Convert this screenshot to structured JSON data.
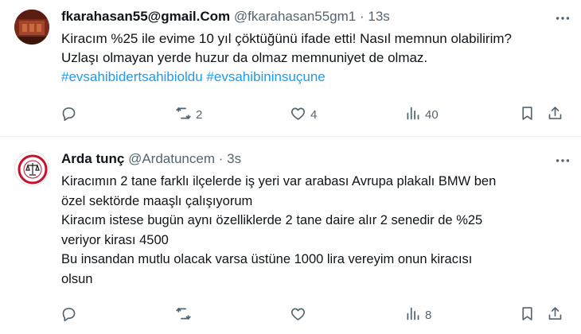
{
  "tweets": [
    {
      "name": "fkarahasan55@gmail.Com",
      "handle": "@fkarahasan55gm1",
      "time": "13s",
      "lines": [
        "Kiracım %25 ile evime 10 yıl çöktüğünü ifade etti! Nasıl memnun olabilirim?",
        "Uzlaşı olmayan yerde huzur da olmaz memnuniyet de olmaz."
      ],
      "hashtags": [
        "#evsahibidertsahibioldu",
        "#evsahibininsuçune"
      ],
      "counts": {
        "replies": "",
        "retweets": "2",
        "likes": "4",
        "views": "40"
      }
    },
    {
      "name": "Arda tunç",
      "handle": "@Ardatuncem",
      "time": "3s",
      "lines": [
        "Kiracımın 2 tane farklı ilçelerde iş yeri var arabası Avrupa plakalı BMW ben",
        "özel sektörde maaşlı çalışıyorum",
        "Kiracım istese bugün aynı özelliklerde 2 tane daire alır 2 senedir de %25",
        "veriyor kirası 4500",
        "Bu insandan mutlu olacak varsa üstüne 1000 lira vereyim onun kiracısı",
        "olsun"
      ],
      "counts": {
        "replies": "",
        "retweets": "",
        "likes": "",
        "views": "8"
      }
    }
  ],
  "separator": " · ",
  "icons": {
    "more": "more-horizontal-icon",
    "reply": "reply-icon",
    "retweet": "retweet-icon",
    "like": "heart-icon",
    "views": "views-chart-icon",
    "bookmark": "bookmark-icon",
    "share": "share-icon"
  },
  "colors": {
    "hashtag": "#1d9bf0",
    "muted": "#536471",
    "text": "#0f1419"
  }
}
